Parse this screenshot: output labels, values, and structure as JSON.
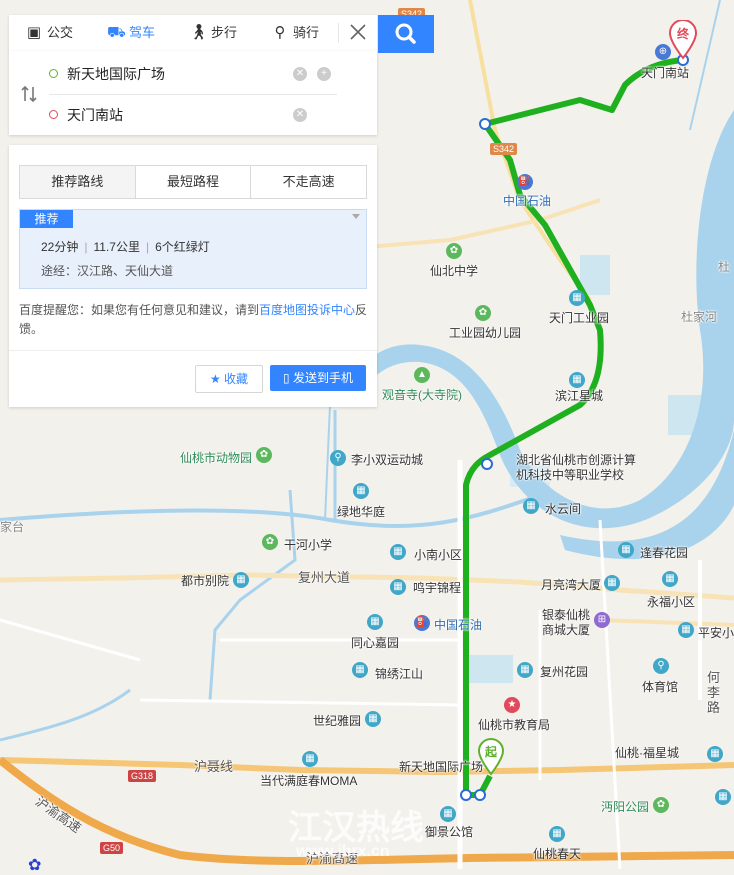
{
  "panel": {
    "modes": [
      {
        "label": "公交",
        "icon": "bus-icon"
      },
      {
        "label": "驾车",
        "icon": "car-icon"
      },
      {
        "label": "步行",
        "icon": "walk-icon"
      },
      {
        "label": "骑行",
        "icon": "bike-icon"
      }
    ],
    "active_mode": "驾车",
    "start": "新天地国际广场",
    "end": "天门南站",
    "tabs": [
      "推荐路线",
      "最短路程",
      "不走高速"
    ],
    "active_tab": "推荐路线",
    "plan": {
      "badge": "推荐",
      "time": "22分钟",
      "distance": "11.7公里",
      "lights": "6个红绿灯",
      "via": "途经：汉江路、天仙大道"
    },
    "notice_prefix": "百度提醒您：如果您有任何意见和建议，请到",
    "notice_link": "百度地图投诉中心",
    "notice_suffix": "反馈。",
    "fav_label": "收藏",
    "send_label": "发送到手机"
  },
  "map": {
    "route_color": "#1fb01f",
    "start_marker": "起",
    "end_marker": "终",
    "labels": {
      "tianmen_south": "天门南站",
      "sinopec1": "中国石油",
      "xianbei_school": "仙北中学",
      "industrial_kg": "工业园幼儿园",
      "tianmen_park": "天门工业园",
      "dujiahe": "杜家河",
      "du": "杜",
      "binjiang": "滨江星城",
      "guanyin": "观音寺(大寺院)",
      "zoo": "仙桃市动物园",
      "lixiaoshuang": "李小双运动城",
      "vocational1": "湖北省仙桃市创源计算",
      "vocational2": "机科技中等职业学校",
      "lvdi": "绿地华庭",
      "shuiyunjian": "水云间",
      "ganhe": "干河小学",
      "xiaonan": "小南小区",
      "fengchun": "逢春花园",
      "dushi": "都市别院",
      "fuzhou": "复州大道",
      "mingyu": "鸣宇锦程",
      "yueliangwan": "月亮湾大厦",
      "yongfu": "永福小区",
      "yintai1": "银泰仙桃",
      "yintai2": "商城大厦",
      "pingan": "平安小",
      "jiakou": "家台",
      "sinopec2": "中国石油",
      "tongxin": "同心嘉园",
      "fuzhou_garden": "复州花园",
      "jinxiu": "锦绣江山",
      "tiyuguan": "体育馆",
      "heli1": "何",
      "heli2": "李",
      "heli3": "路",
      "shiji": "世纪雅园",
      "education": "仙桃市教育局",
      "husheng": "沪聂线",
      "fuxing": "仙桃·福星城",
      "dangdai": "当代满庭春MOMA",
      "xintiandi": "新天地国际广场",
      "hurong_hw": "沪渝高速",
      "hurong_hw2": "沪渝高速",
      "mianyang": "沔阳公园",
      "yujing": "御景公馆",
      "chuntian": "仙桃春天",
      "s342a": "S342",
      "s342b": "S342",
      "g318": "G318",
      "g50": "G50"
    },
    "watermark_cn": "江汉热线",
    "watermark_url": "www.jhrx.cn"
  }
}
